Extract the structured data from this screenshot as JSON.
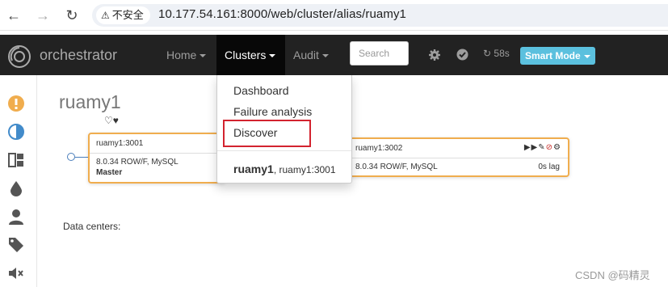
{
  "browser": {
    "security_label": "不安全",
    "url": "10.177.54.161:8000/web/cluster/alias/ruamy1"
  },
  "navbar": {
    "brand": "orchestrator",
    "menu": [
      {
        "label": "Home"
      },
      {
        "label": "Clusters"
      },
      {
        "label": "Audit"
      }
    ],
    "search_placeholder": "Search",
    "timer": "58s",
    "mode_button": "Smart Mode"
  },
  "dropdown": {
    "items": [
      {
        "label": "Dashboard"
      },
      {
        "label": "Failure analysis"
      },
      {
        "label": "Discover"
      }
    ],
    "cluster": {
      "name": "ruamy1",
      "alias": ", ruamy1:3001"
    }
  },
  "main": {
    "cluster_title": "ruamy1",
    "hearts": "♡♥",
    "instances": [
      {
        "host": "ruamy1:3001",
        "version": "8.0.34 ROW/F, MySQL",
        "role": "Master"
      },
      {
        "host": "ruamy1:3002",
        "version": "8.0.34 ROW/F, MySQL",
        "lag": "0s lag"
      }
    ],
    "data_centers_label": "Data centers:"
  },
  "colors": {
    "navbar_bg": "#222222",
    "accent": "#5bc0de",
    "instance_border": "#f0ad4e",
    "highlight": "#d3232f"
  },
  "watermark": "CSDN @码精灵"
}
